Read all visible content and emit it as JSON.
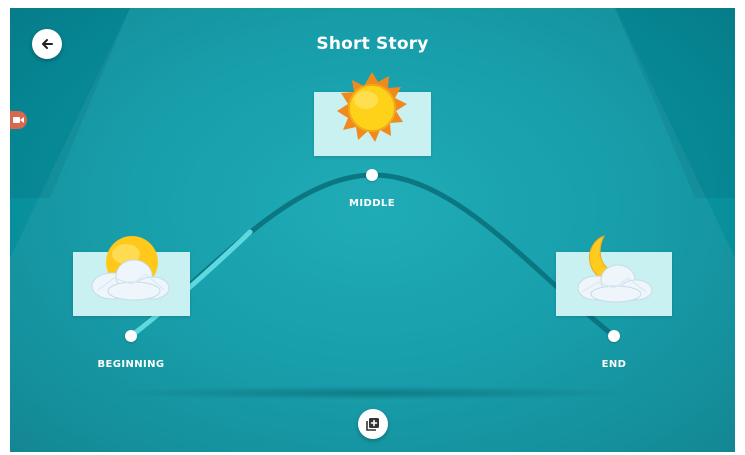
{
  "header": {
    "title": "Short Story",
    "back_icon": "arrow-left-icon"
  },
  "side_tab": {
    "icon": "video-camera-icon",
    "color": "#d9684f"
  },
  "story_points": [
    {
      "label": "BEGINNING",
      "icon": "sun-behind-cloud-icon"
    },
    {
      "label": "MIDDLE",
      "icon": "sun-icon"
    },
    {
      "label": "END",
      "icon": "moon-behind-cloud-icon"
    }
  ],
  "footer": {
    "add_icon": "add-page-icon"
  },
  "colors": {
    "background": "#0a9aa7",
    "card": "#c9f1f2",
    "arc_highlight": "#5fd9e0",
    "arc_dark": "#086f7a"
  }
}
